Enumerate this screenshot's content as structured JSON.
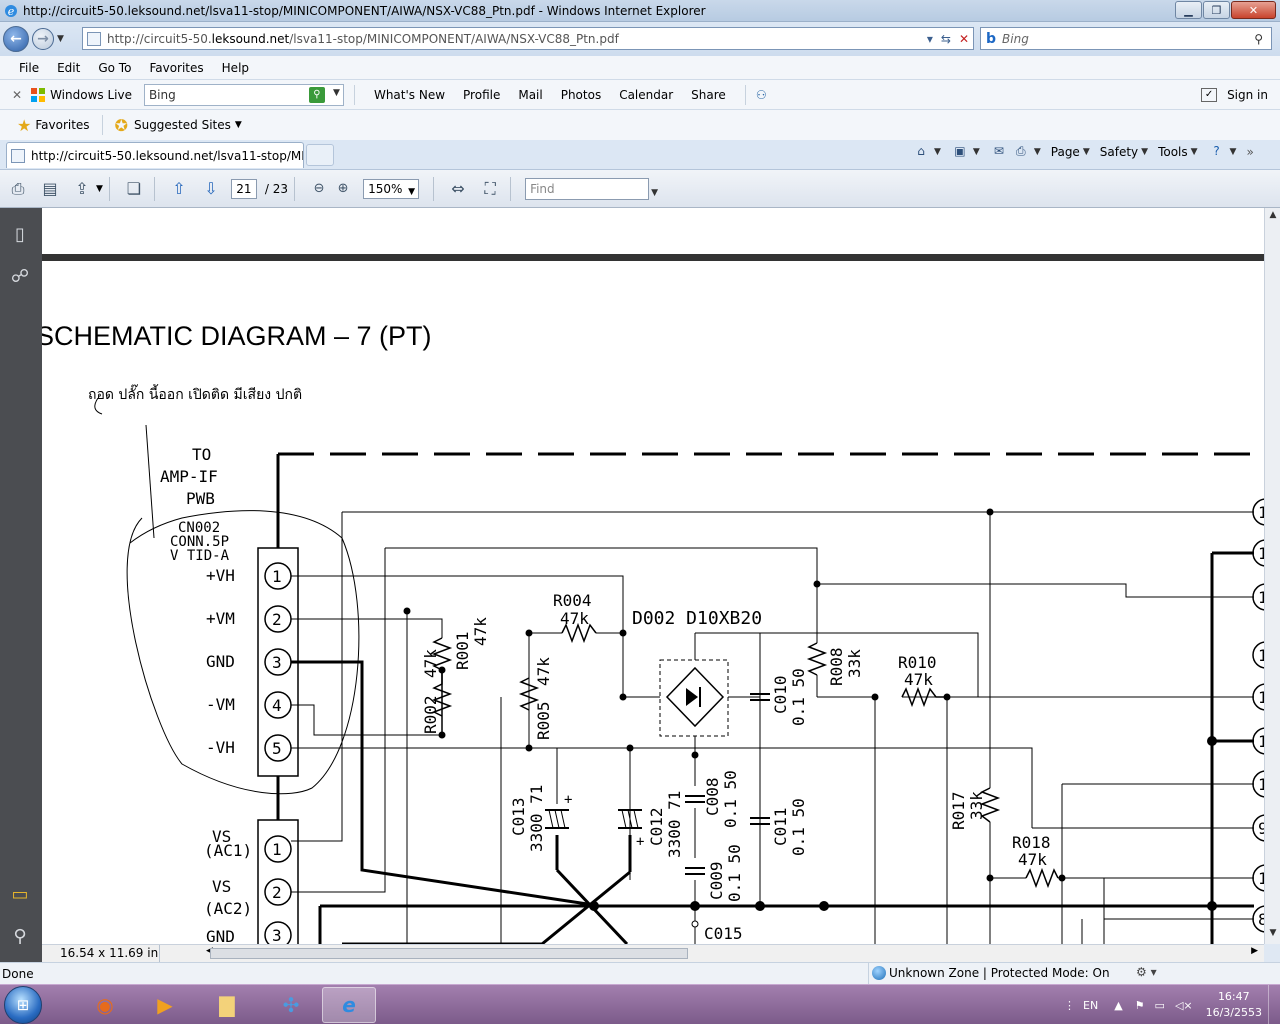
{
  "window": {
    "title": "http://circuit5-50.leksound.net/lsva11-stop/MINICOMPONENT/AIWA/NSX-VC88_Ptn.pdf - Windows Internet Explorer",
    "min_icon": "minimize-icon",
    "max_icon": "maximize-icon",
    "close_icon": "close-icon"
  },
  "address": {
    "url_prefix": "http://circuit5-50.",
    "url_domain": "leksound.net",
    "url_suffix": "/lsva11-stop/MINICOMPONENT/AIWA/NSX-VC88_Ptn.pdf",
    "search_placeholder": "Bing"
  },
  "menu": [
    "File",
    "Edit",
    "Go To",
    "Favorites",
    "Help"
  ],
  "livebar": {
    "brand": "Windows Live",
    "search_value": "Bing",
    "links": [
      "What's New",
      "Profile",
      "Mail",
      "Photos",
      "Calendar",
      "Share"
    ],
    "signin": "Sign in"
  },
  "favbar": {
    "favorites": "Favorites",
    "suggested": "Suggested Sites"
  },
  "tab": {
    "label": "http://circuit5-50.leksound.net/lsva11-stop/MINI..."
  },
  "cmdbar": {
    "page": "Page",
    "safety": "Safety",
    "tools": "Tools"
  },
  "pdf_toolbar": {
    "current_page": "21",
    "total_pages": "/ 23",
    "zoom": "150%",
    "find_placeholder": "Find"
  },
  "pdf_content": {
    "heading": "SCHEMATIC  DIAGRAM – 7 (PT)",
    "handwritten_note": "ถอด  ปลั๊ก  นี้ออก  เปิดติด  มีเสียง  ปกติ",
    "to_label": [
      "TO",
      "AMP-IF",
      "PWB"
    ],
    "conn_label": [
      "CN002",
      "CONN.5P",
      "V TID-A"
    ],
    "pins": [
      {
        "num": "1",
        "label": "+VH"
      },
      {
        "num": "2",
        "label": "+VM"
      },
      {
        "num": "3",
        "label": "GND"
      },
      {
        "num": "4",
        "label": "-VM"
      },
      {
        "num": "5",
        "label": "-VH"
      }
    ],
    "pins2": [
      {
        "num": "1",
        "label": "VS",
        "sub": "(AC1)"
      },
      {
        "num": "2",
        "label": "VS",
        "sub": "(AC2)"
      },
      {
        "num": "3",
        "label": "GND",
        "sub": ""
      }
    ],
    "components": {
      "r004": "R004",
      "r004v": "47k",
      "d002": "D002  D10XB20",
      "r001": "R001",
      "r001v": "47k",
      "r002": "R002",
      "r002v": "47k",
      "r005": "R005",
      "r005v": "47k",
      "r008": "R008",
      "r008v": "33k",
      "r010": "R010",
      "r010v": "47k",
      "r017": "R017",
      "r017v": "33k",
      "r018": "R018",
      "r018v": "47k",
      "c013": "C013",
      "c013v": "3300 71",
      "c012": "C012",
      "c012v": "3300 71",
      "c008": "C008",
      "c008v": "0.1 50",
      "c009": "C009",
      "c009v": "0.1 50",
      "c010": "C010",
      "c010v": "0.1 50",
      "c011": "C011",
      "c011v": "0.1 50",
      "c015": "C015"
    },
    "right_pins": [
      "1",
      "1",
      "1",
      "1",
      "1",
      "1",
      "1",
      "9",
      "1",
      "8"
    ]
  },
  "pdf_status": {
    "page_size": "16.54 x 11.69 in"
  },
  "statusbar": {
    "done": "Done",
    "zone": "Unknown Zone | Protected Mode: On"
  },
  "taskbar": {
    "lang": "EN",
    "time": "16:47",
    "date": "16/3/2553"
  }
}
